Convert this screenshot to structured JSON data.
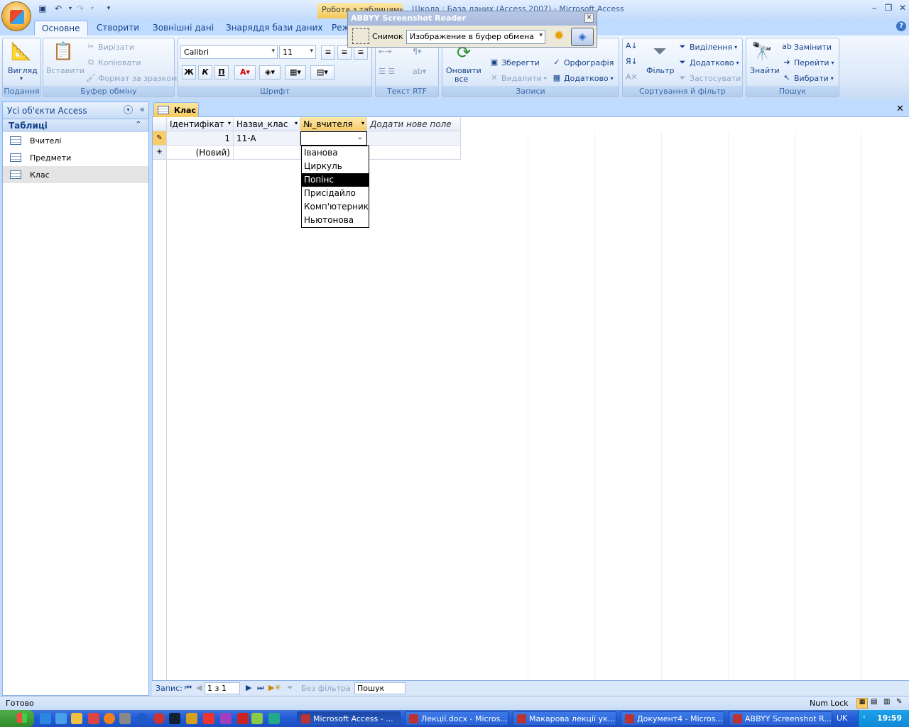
{
  "window": {
    "title": "Школа : База даних (Access 2007) - Microsoft Access",
    "context_tab": "Робота з таблицями",
    "controls": [
      "minimize-icon",
      "maximize-icon",
      "close-icon"
    ]
  },
  "ribbon": {
    "tabs": [
      "Основне",
      "Створити",
      "Зовнішні дані",
      "Знаряддя бази даних",
      "Реж"
    ],
    "active_tab": "Основне",
    "groups": {
      "views": {
        "label": "Подання",
        "view_button": "Вигляд"
      },
      "clipboard": {
        "label": "Буфер обміну",
        "paste": "Вставити",
        "cut": "Вирізати",
        "copy": "Копіювати",
        "format_painter": "Формат за зразком"
      },
      "font": {
        "label": "Шрифт",
        "font_name": "Calibri",
        "font_size": "11",
        "bold": "Ж",
        "italic": "К",
        "underline": "П"
      },
      "rtf": {
        "label": "Текст RTF"
      },
      "records": {
        "label": "Записи",
        "refresh": "Оновити",
        "refresh2": "все",
        "save": "Зберегти",
        "delete": "Видалити",
        "spelling": "Орфографія",
        "more": "Додатково"
      },
      "sort": {
        "label": "Сортування й фільтр",
        "filter": "Фільтр",
        "selection": "Виділення",
        "advanced": "Додатково",
        "apply": "Застосувати"
      },
      "find": {
        "label": "Пошук",
        "find": "Знайти",
        "replace": "Замінити",
        "goto": "Перейти",
        "select": "Вибрати"
      }
    }
  },
  "abbyy": {
    "title": "ABBYY Screenshot Reader",
    "snapshot_label": "Снимок",
    "target_value": "Изображение в буфер обмена"
  },
  "nav_pane": {
    "header": "Усі об'єкти Access",
    "category": "Таблиці",
    "items": [
      {
        "label": "Вчителі",
        "selected": false
      },
      {
        "label": "Предмети",
        "selected": false
      },
      {
        "label": "Клас",
        "selected": true
      }
    ]
  },
  "document": {
    "tab_label": "Клас",
    "columns": [
      "Ідентифікат",
      "Назви_клас",
      "№_вчителя",
      "Додати нове поле"
    ],
    "rows": [
      {
        "id": "1",
        "name": "11-A",
        "teacher": ""
      },
      {
        "id": "(Новий)",
        "name": "",
        "teacher": ""
      }
    ],
    "dropdown": {
      "options": [
        "Іванова",
        "Циркуль",
        "Попінс",
        "Присідайло",
        "Комп'ютерник",
        "Ньютонова"
      ],
      "highlighted_index": 2
    }
  },
  "record_nav": {
    "label": "Запис:",
    "position": "1 з 1",
    "filter": "Без фільтра",
    "search": "Пошук"
  },
  "status_bar": {
    "left": "Готово",
    "num_lock": "Num Lock"
  },
  "taskbar": {
    "tasks": [
      {
        "label": "Microsoft Access - ...",
        "active": true
      },
      {
        "label": "Лекції.docx - Micros...",
        "active": false
      },
      {
        "label": "Макарова лекції ук...",
        "active": false
      },
      {
        "label": "Документ4 - Micros...",
        "active": false
      },
      {
        "label": "ABBYY Screenshot R...",
        "active": false
      }
    ],
    "language": "UK",
    "clock": "19:59"
  }
}
